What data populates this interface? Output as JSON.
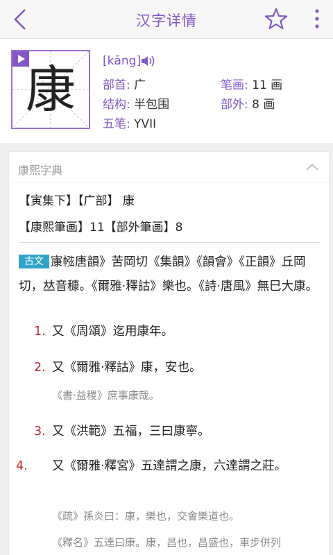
{
  "header": {
    "title": "汉字详情"
  },
  "character": {
    "glyph": "康",
    "pinyin": "[kāng]",
    "fields": [
      {
        "label": "部首:",
        "value": "广"
      },
      {
        "label": "笔画:",
        "value": "11 画"
      },
      {
        "label": "结构:",
        "value": "半包围"
      },
      {
        "label": "部外:",
        "value": "8 画"
      },
      {
        "label": "五笔:",
        "value": "YVII"
      }
    ]
  },
  "kangxi": {
    "section_title": "康熙字典",
    "line1": "【寅集下】【广部】 康",
    "line2": "【康熙筆画】11【部外筆画】8",
    "tag": "古文",
    "intro": "㝩㡉唐韻》苦岡切《集韻》《韻會》《正韻》丘岡切，𠀤音穅。《爾雅·釋詁》樂也。《詩·唐風》無巳大康。",
    "items": [
      {
        "num": "1.",
        "text": "又《周頌》迄用康年。",
        "cite": ""
      },
      {
        "num": "2.",
        "text": "又《爾雅·釋詁》康，安也。",
        "cite": "《書·益稷》庶事康哉。"
      },
      {
        "num": "3.",
        "text": "又《洪範》五福，三曰康寧。",
        "cite": ""
      },
      {
        "num": "4.",
        "text": "又《爾雅·釋宮》五達謂之康，六達謂之莊。",
        "cite": "《疏》孫炎曰：康，樂也，交會樂道也。"
      }
    ],
    "extra_cite": "《釋名》五達曰康。康，昌也，昌盛也，車步併列"
  },
  "colors": {
    "accent": "#8257c6",
    "tag": "#30a4c7",
    "number": "#c0262d"
  }
}
